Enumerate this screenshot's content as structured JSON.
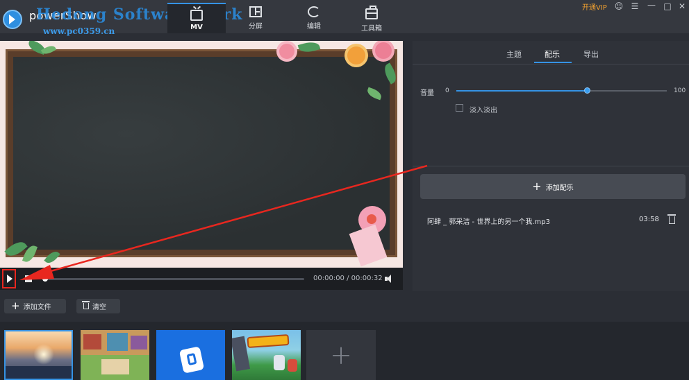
{
  "header": {
    "app_name": "powerShow",
    "watermark": "Hedong Software Park",
    "watermark_url": "www.pc0359.cn",
    "tabs": [
      {
        "label": "MV",
        "icon": "tv-icon",
        "active": true
      },
      {
        "label": "分屏",
        "icon": "split-screen-icon",
        "active": false
      },
      {
        "label": "编辑",
        "icon": "refresh-icon",
        "active": false
      },
      {
        "label": "工具箱",
        "icon": "toolbox-icon",
        "active": false
      }
    ],
    "vip_label": "开通VIP",
    "window_icons": [
      "user-icon",
      "menu-icon",
      "minimize-icon",
      "maximize-icon",
      "close-icon"
    ]
  },
  "player": {
    "current_time": "00:00:00",
    "separator": " / ",
    "total_time": "00:00:32",
    "progress": 0
  },
  "right_panel": {
    "tabs": [
      "主题",
      "配乐",
      "导出"
    ],
    "active_tab": "配乐",
    "volume": {
      "label": "音量",
      "min": "0",
      "max": "100",
      "value": 62
    },
    "fade_label": "淡入淡出",
    "fade_checked": false,
    "add_music_label": "添加配乐",
    "track": {
      "name": "阿肆 _ 郭采洁 - 世界上的另一个我.mp3",
      "duration": "03:58"
    }
  },
  "toolbar": {
    "add_file_label": "添加文件",
    "clear_label": "清空"
  },
  "media": {
    "thumbnails": [
      "sunset-lake",
      "pixel-game-town",
      "alipay-app",
      "game-promo"
    ],
    "selected_index": 0
  },
  "colors": {
    "accent": "#3593e5",
    "annotation_red": "#e8271f",
    "vip": "#f0a030"
  }
}
